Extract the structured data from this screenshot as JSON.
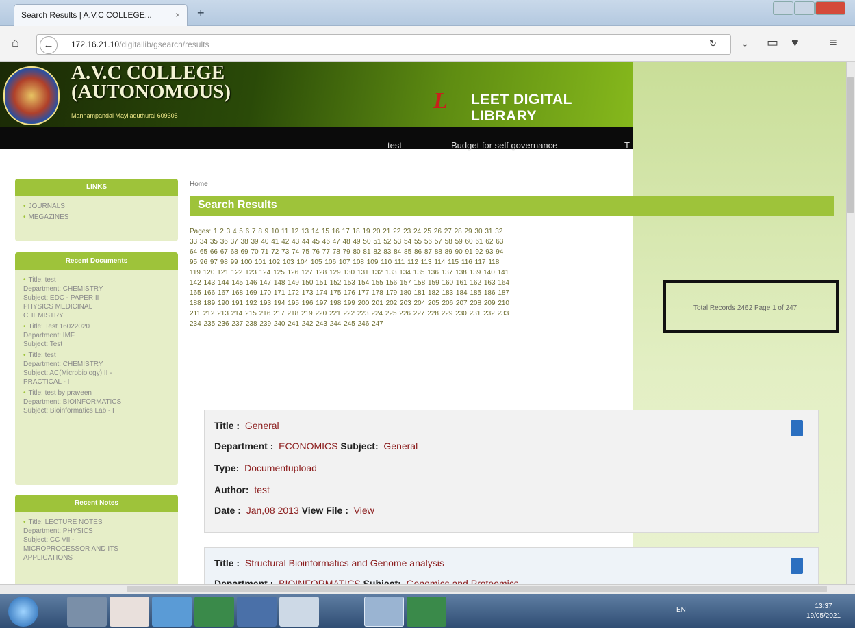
{
  "browser": {
    "tab_title": "Search Results | A.V.C COLLEGE...",
    "tab_close": "×",
    "new_tab": "+",
    "url_host": "172.16.21.10",
    "url_path": "/digitallib/gsearch/results"
  },
  "site": {
    "college_line1": "A.V.C COLLEGE",
    "college_line2": "(AUTONOMOUS)",
    "tagline": "Mannampandal Mayiladuthurai 609305",
    "library_title": "LEET DIGITAL LIBRARY",
    "nav": [
      "test",
      "Budget for self governance",
      "T"
    ]
  },
  "sidebar": {
    "links_title": "LINKS",
    "links": [
      "JOURNALS",
      "MEGAZINES"
    ],
    "recent_docs_title": "Recent Documents",
    "recent_docs": [
      [
        "Title: test",
        "Department: CHEMISTRY",
        "Subject: EDC - PAPER II",
        "PHYSICS MEDICINAL",
        "CHEMISTRY"
      ],
      [
        "Title: Test 16022020",
        "Department: IMF",
        "Subject: Test"
      ],
      [
        "Title: test",
        "Department: CHEMISTRY",
        "Subject: AC(Microbiology) II -",
        "PRACTICAL - I"
      ],
      [
        "Title: test by praveen",
        "Department: BIOINFORMATICS",
        "Subject: Bioinformatics Lab - I"
      ]
    ],
    "recent_notes_title": "Recent Notes",
    "recent_notes": [
      [
        "Title: LECTURE NOTES",
        "Department: PHYSICS",
        "Subject: CC VII -",
        "MICROPROCESSOR AND ITS",
        "APPLICATIONS"
      ]
    ]
  },
  "main": {
    "breadcrumb": "Home",
    "heading": "Search Results",
    "pages_label": "Pages:",
    "page_count": 247,
    "total_text": "Total Records 2462   Page 1 of 247",
    "records": [
      {
        "title_label": "Title :",
        "title": "General",
        "dept_label": "Department :",
        "dept": "ECONOMICS",
        "subject_label": "Subject:",
        "subject": "General",
        "type_label": "Type:",
        "type": "Documentupload",
        "author_label": "Author:",
        "author": "test",
        "date_label": "Date :",
        "date": "Jan,08 2013",
        "file_label": "View File :",
        "file": "View"
      },
      {
        "title_label": "Title :",
        "title": "Structural Bioinformatics and Genome analysis",
        "dept_label": "Department :",
        "dept": "BIOINFORMATICS",
        "subject_label": "Subject:",
        "subject": "Genomics and Proteomics"
      }
    ]
  },
  "taskbar": {
    "lang": "EN",
    "time": "13:37",
    "date": "19/05/2021"
  }
}
